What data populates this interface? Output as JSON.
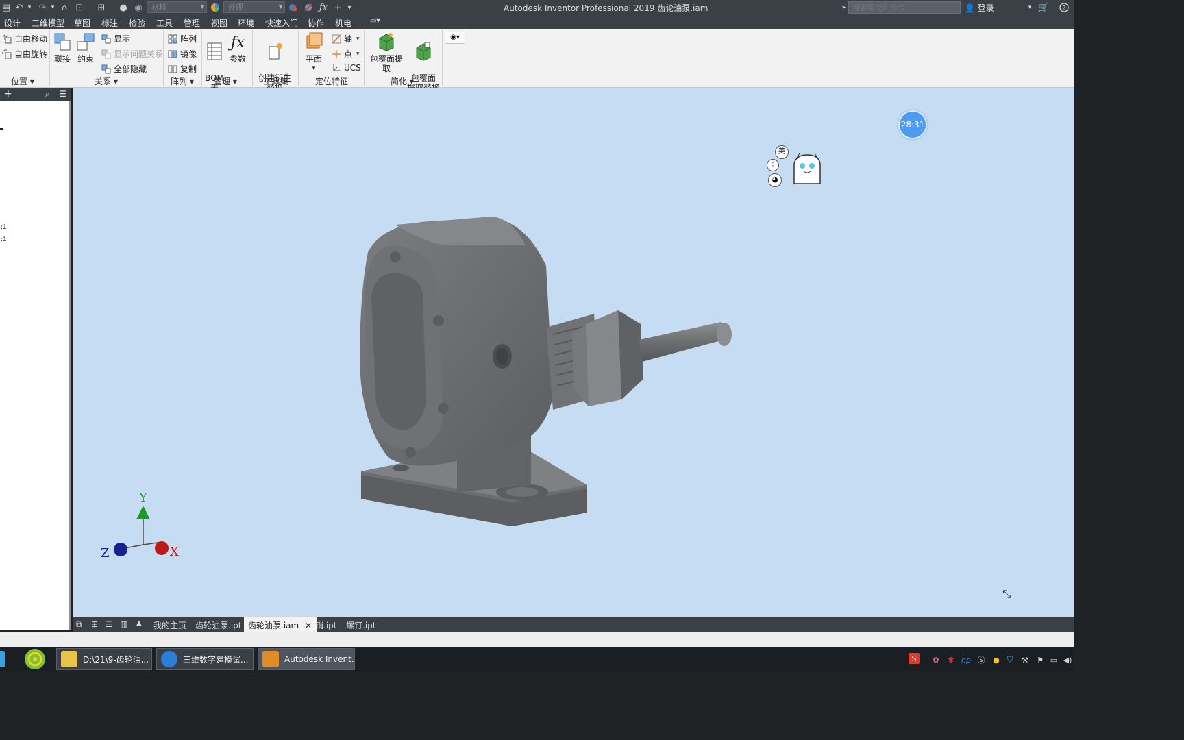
{
  "titlebar": {
    "app_title": "Autodesk Inventor Professional 2019    齿轮油泵.iam",
    "material_dropdown": "材料",
    "appearance_dropdown": "外观",
    "search_placeholder": "搜索帮助和命令...",
    "login_label": "登录"
  },
  "menu": {
    "tabs": [
      "设计",
      "三维模型",
      "草图",
      "标注",
      "检验",
      "工具",
      "管理",
      "视图",
      "环境",
      "快速入门",
      "协作",
      "机电"
    ]
  },
  "ribbon": {
    "position": {
      "free_move": "自由移动",
      "free_rotate": "自由旋转",
      "label": "位置"
    },
    "relations": {
      "join": "联接",
      "constrain": "约束",
      "show": "显示",
      "show_sick": "显示问题关系",
      "hide_all": "全部隐藏",
      "label": "关系"
    },
    "pattern": {
      "pattern": "阵列",
      "mirror": "镜像",
      "copy": "复制",
      "label": "阵列"
    },
    "manage": {
      "bom": "BOM\n表",
      "params": "参数",
      "label": "管理"
    },
    "tools": {
      "derive": "创建衍生\n替换",
      "label": "工具集"
    },
    "work_features": {
      "plane": "平面",
      "axis": "轴",
      "point": "点",
      "ucs": "UCS",
      "label": "定位特征"
    },
    "simplify": {
      "shrinkwrap": "包覆面提取",
      "shrinkwrap_sub": "包覆面\n提取替换",
      "label": "简化"
    }
  },
  "browser": {
    "lines": [
      ":1",
      ":1"
    ]
  },
  "viewport": {
    "timer": "28:31",
    "ime_label": "英",
    "triad": {
      "x": "X",
      "y": "Y",
      "z": "Z"
    }
  },
  "doctabs": {
    "tabs": [
      "我的主页",
      "齿轮油泵.ipt",
      "齿轮油泵.iam",
      "销.ipt",
      "螺钉.ipt"
    ],
    "active_index": 2
  },
  "taskbar": {
    "items": [
      "D:\\21\\9-齿轮油...",
      "三维数字建模试...",
      "Autodesk Invent..."
    ]
  },
  "colors": {
    "viewport_bg": "#c5dcf2",
    "model_gray": "#707274",
    "chrome_dark": "#3b4047",
    "timer_blue": "#4d9cf0"
  }
}
